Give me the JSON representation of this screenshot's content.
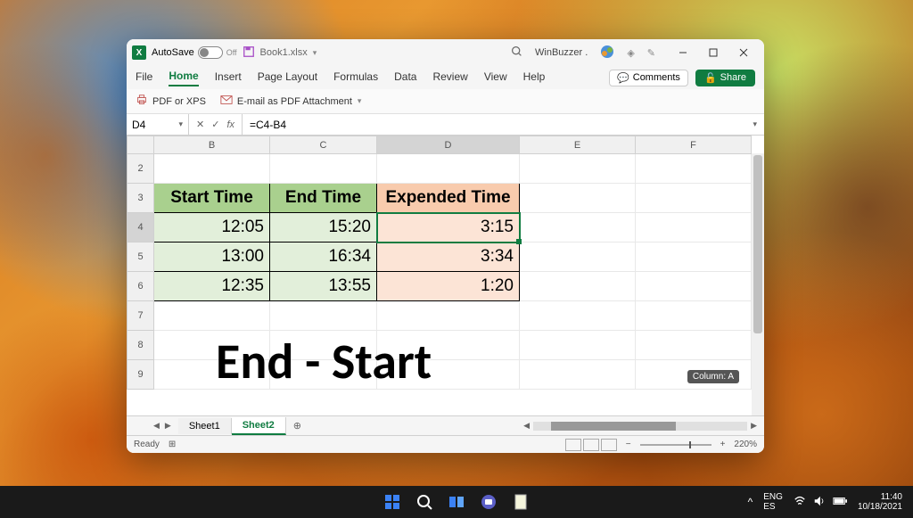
{
  "titlebar": {
    "autosave_label": "AutoSave",
    "autosave_state": "Off",
    "filename": "Book1.xlsx",
    "search_label": "Search",
    "account": "WinBuzzer ."
  },
  "ribbon": {
    "tabs": [
      "File",
      "Home",
      "Insert",
      "Page Layout",
      "Formulas",
      "Data",
      "Review",
      "View",
      "Help"
    ],
    "active": "Home",
    "comments": "Comments",
    "share": "Share"
  },
  "quick": {
    "pdf": "PDF or XPS",
    "email": "E-mail as PDF Attachment"
  },
  "formula": {
    "cell_ref": "D4",
    "fx_label": "fx",
    "formula": "=C4-B4"
  },
  "columns": [
    "B",
    "C",
    "D",
    "E",
    "F"
  ],
  "rows": [
    "2",
    "3",
    "4",
    "5",
    "6",
    "7",
    "8",
    "9"
  ],
  "headers": {
    "start": "Start Time",
    "end": "End Time",
    "expended": "Expended Time"
  },
  "data_rows": [
    {
      "start": "12:05",
      "end": "15:20",
      "expended": "3:15"
    },
    {
      "start": "13:00",
      "end": "16:34",
      "expended": "3:34"
    },
    {
      "start": "12:35",
      "end": "13:55",
      "expended": "1:20"
    }
  ],
  "overlay_text": "End - Start",
  "tooltip": "Column: A",
  "sheets": {
    "tabs": [
      "Sheet1",
      "Sheet2"
    ],
    "active": "Sheet2"
  },
  "status": {
    "ready": "Ready",
    "zoom": "220%"
  },
  "sys": {
    "lang1": "ENG",
    "lang2": "ES",
    "time": "11:40",
    "date": "10/18/2021"
  }
}
